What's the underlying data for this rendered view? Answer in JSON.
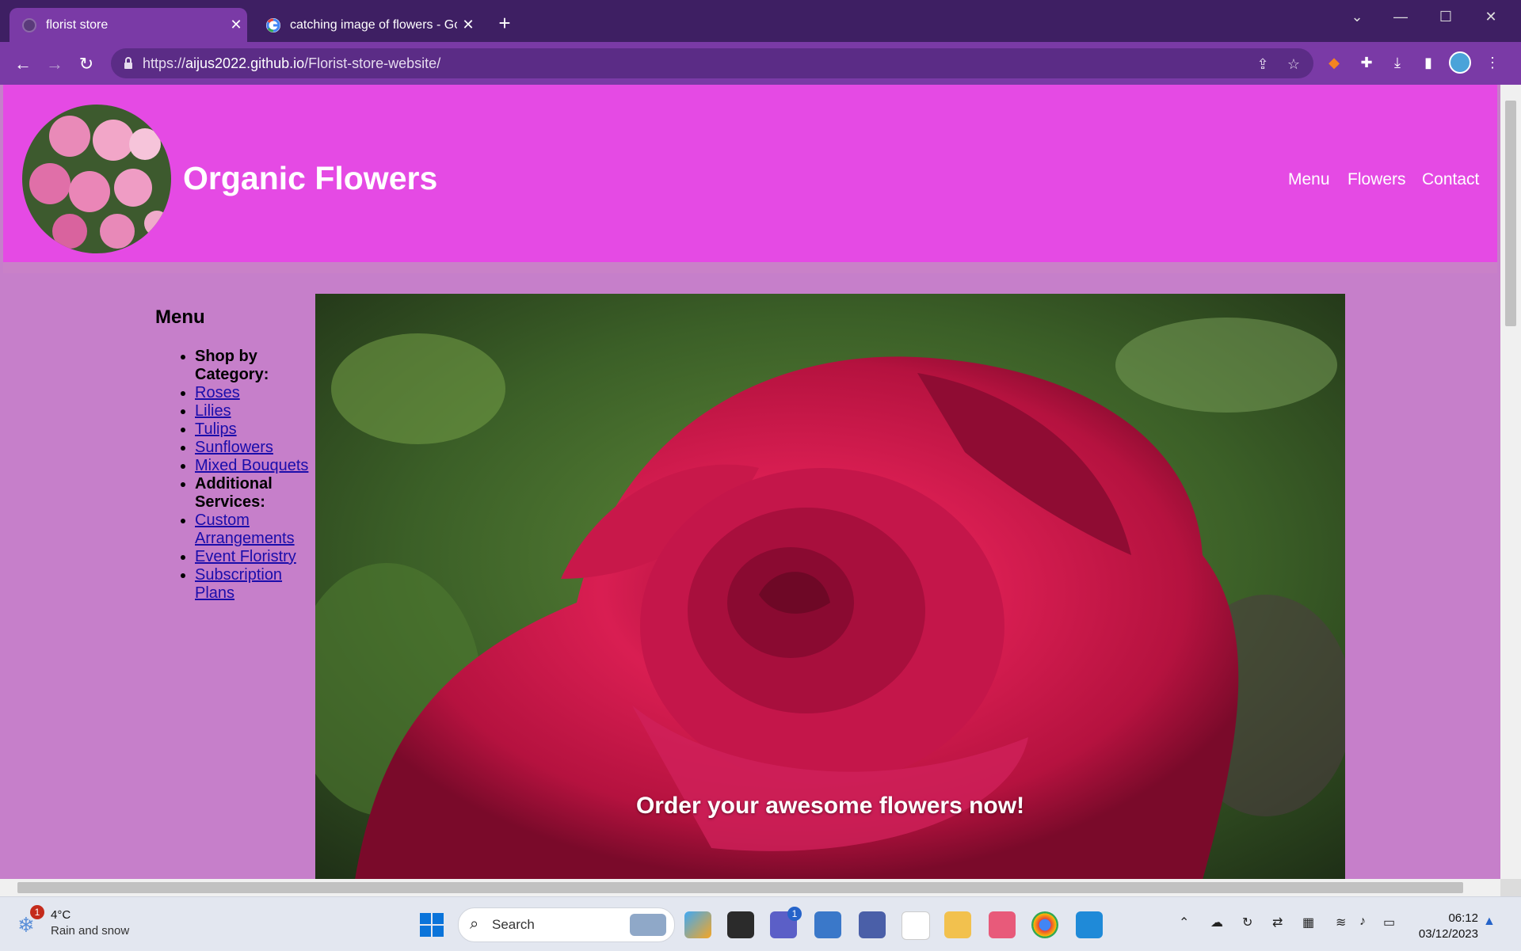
{
  "browser": {
    "tabs": [
      {
        "title": "florist store",
        "active": true
      },
      {
        "title": "catching image of flowers - Goo",
        "active": false
      }
    ],
    "new_tab_label": "+",
    "url_prefix": "https://",
    "url_host": "aijus2022.github.io",
    "url_path": "/Florist-store-website/",
    "colors": {
      "tabstrip": "#3e1f63",
      "toolbar": "#7a3aa6",
      "omnibox": "#5b2c86"
    }
  },
  "site": {
    "title": "Organic Flowers",
    "nav": [
      "Menu",
      "Flowers",
      "Contact"
    ],
    "colors": {
      "header": "#e54ae4",
      "body": "#c67fca",
      "link": "#1a0dab"
    },
    "menu": {
      "heading": "Menu",
      "items": [
        {
          "label": "Shop by Category:",
          "kind": "heading"
        },
        {
          "label": "Roses",
          "kind": "link"
        },
        {
          "label": "Lilies",
          "kind": "link"
        },
        {
          "label": "Tulips",
          "kind": "link"
        },
        {
          "label": "Sunflowers",
          "kind": "link"
        },
        {
          "label": "Mixed Bouquets",
          "kind": "link"
        },
        {
          "label": "Additional Services:",
          "kind": "heading"
        },
        {
          "label": "Custom Arrangements",
          "kind": "link"
        },
        {
          "label": "Event Floristry",
          "kind": "link"
        },
        {
          "label": "Subscription Plans",
          "kind": "link"
        }
      ]
    },
    "hero_caption": "Order your awesome flowers now!"
  },
  "taskbar": {
    "weather_temp": "4°C",
    "weather_condition": "Rain and snow",
    "weather_badge": "1",
    "search_label": "Search",
    "chat_badge": "1",
    "time": "06:12",
    "date": "03/12/2023"
  }
}
